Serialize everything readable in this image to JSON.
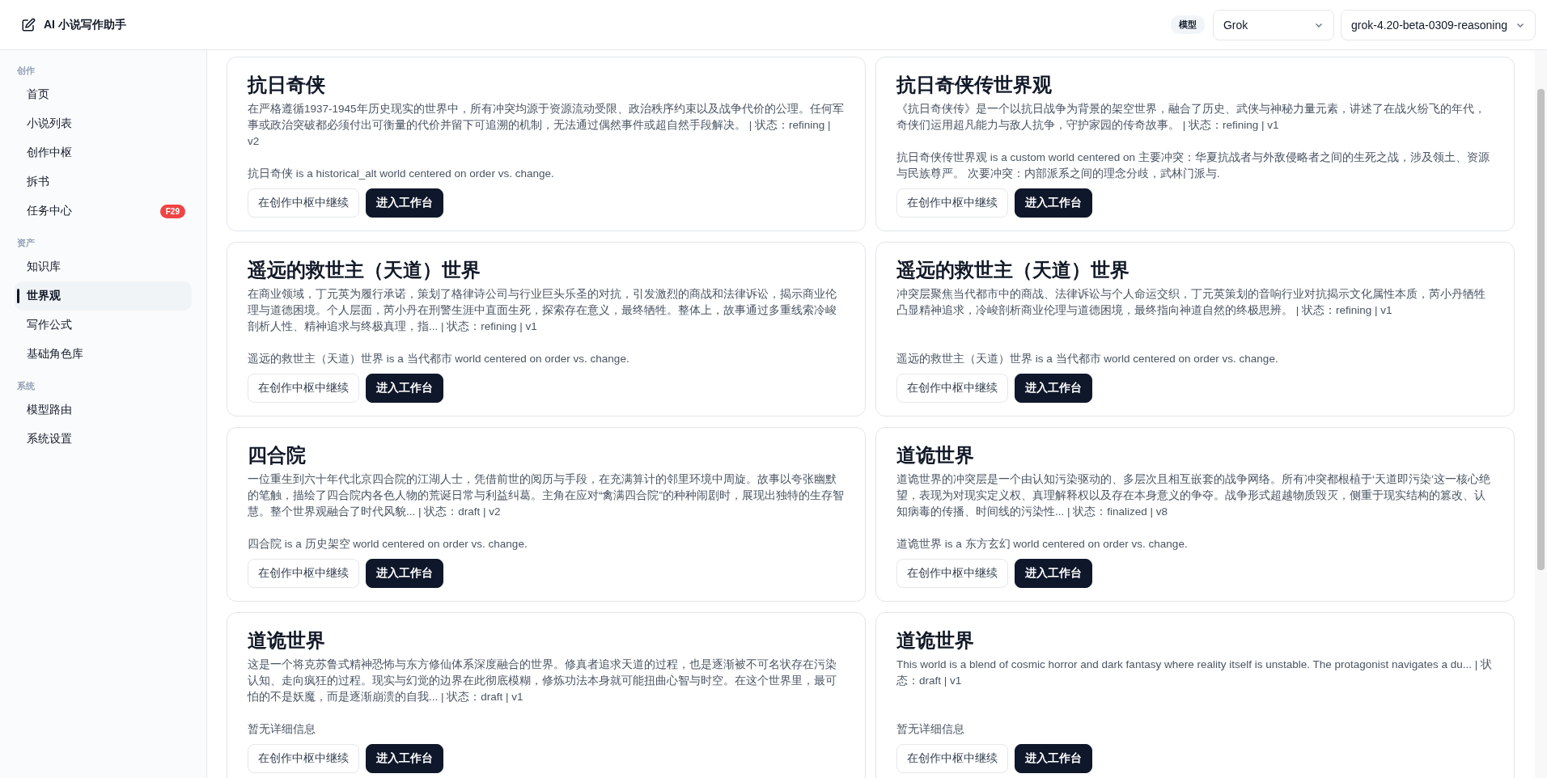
{
  "header": {
    "title": "AI 小说写作助手",
    "model_label": "模型",
    "provider_select": "Grok",
    "model_select": "grok-4.20-beta-0309-reasoning"
  },
  "sidebar": {
    "groups": [
      {
        "label": "创作",
        "items": [
          {
            "label": "首页",
            "selected": false
          },
          {
            "label": "小说列表",
            "selected": false
          },
          {
            "label": "创作中枢",
            "selected": false
          },
          {
            "label": "拆书",
            "selected": false
          },
          {
            "label": "任务中心",
            "selected": false,
            "badge": "F29"
          }
        ]
      },
      {
        "label": "资产",
        "items": [
          {
            "label": "知识库",
            "selected": false
          },
          {
            "label": "世界观",
            "selected": true
          },
          {
            "label": "写作公式",
            "selected": false
          },
          {
            "label": "基础角色库",
            "selected": false
          }
        ]
      },
      {
        "label": "系统",
        "items": [
          {
            "label": "模型路由",
            "selected": false
          },
          {
            "label": "系统设置",
            "selected": false
          }
        ]
      }
    ]
  },
  "cards": [
    {
      "title": "抗日奇侠",
      "description": "在严格遵循1937-1945年历史现实的世界中，所有冲突均源于资源流动受限、政治秩序约束以及战争代价的公理。任何军事或政治突破都必须付出可衡量的代价并留下可追溯的机制，无法通过偶然事件或超自然手段解决。 | 状态：refining | v2",
      "summary": "抗日奇侠 is a historical_alt world centered on order vs. change.",
      "continue_button": "在创作中枢中继续",
      "open_button": "进入工作台"
    },
    {
      "title": "抗日奇侠传世界观",
      "description": "《抗日奇侠传》是一个以抗日战争为背景的架空世界，融合了历史、武侠与神秘力量元素，讲述了在战火纷飞的年代，奇侠们运用超凡能力与敌人抗争，守护家园的传奇故事。 | 状态：refining | v1",
      "summary": "抗日奇侠传世界观 is a custom world centered on 主要冲突：华夏抗战者与外敌侵略者之间的生死之战，涉及领土、资源与民族尊严。 次要冲突：内部派系之间的理念分歧，武林门派与.",
      "continue_button": "在创作中枢中继续",
      "open_button": "进入工作台"
    },
    {
      "title": "遥远的救世主（天道）世界",
      "description": "在商业领域，丁元英为履行承诺，策划了格律诗公司与行业巨头乐圣的对抗，引发激烈的商战和法律诉讼，揭示商业伦理与道德困境。个人层面，芮小丹在刑警生涯中直面生死，探索存在意义，最终牺牲。整体上，故事通过多重线索冷峻剖析人性、精神追求与终极真理，指... | 状态：refining | v1",
      "summary": "遥远的救世主（天道）世界 is a 当代都市 world centered on order vs. change.",
      "continue_button": "在创作中枢中继续",
      "open_button": "进入工作台"
    },
    {
      "title": "遥远的救世主（天道）世界",
      "description": "冲突层聚焦当代都市中的商战、法律诉讼与个人命运交织，丁元英策划的音响行业对抗揭示文化属性本质，芮小丹牺牲凸显精神追求，冷峻剖析商业伦理与道德困境，最终指向神道自然的终极思辨。 | 状态：refining | v1",
      "summary": "遥远的救世主（天道）世界 is a 当代都市 world centered on order vs. change.",
      "continue_button": "在创作中枢中继续",
      "open_button": "进入工作台"
    },
    {
      "title": "四合院",
      "description": "一位重生到六十年代北京四合院的江湖人士，凭借前世的阅历与手段，在充满算计的邻里环境中周旋。故事以夸张幽默的笔触，描绘了四合院内各色人物的荒诞日常与利益纠葛。主角在应对“禽满四合院”的种种闹剧时，展现出独特的生存智慧。整个世界观融合了时代风貌... | 状态：draft | v2",
      "summary": "四合院 is a 历史架空 world centered on order vs. change.",
      "continue_button": "在创作中枢中继续",
      "open_button": "进入工作台"
    },
    {
      "title": "道诡世界",
      "description": "道诡世界的冲突层是一个由认知污染驱动的、多层次且相互嵌套的战争网络。所有冲突都根植于‘天道即污染’这一核心绝望，表现为对现实定义权、真理解释权以及存在本身意义的争夺。战争形式超越物质毁灭，侧重于现实结构的篡改、认知病毒的传播、时间线的污染性... | 状态：finalized | v8",
      "summary": "道诡世界 is a 东方玄幻 world centered on order vs. change.",
      "continue_button": "在创作中枢中继续",
      "open_button": "进入工作台"
    },
    {
      "title": "道诡世界",
      "description": "这是一个将克苏鲁式精神恐怖与东方修仙体系深度融合的世界。修真者追求天道的过程，也是逐渐被不可名状存在污染认知、走向疯狂的过程。现实与幻觉的边界在此彻底模糊，修炼功法本身就可能扭曲心智与时空。在这个世界里，最可怕的不是妖魔，而是逐渐崩溃的自我... | 状态：draft | v1",
      "summary": "暂无详细信息",
      "continue_button": "在创作中枢中继续",
      "open_button": "进入工作台"
    },
    {
      "title": "道诡世界",
      "description": "This world is a blend of cosmic horror and dark fantasy where reality itself is unstable. The protagonist navigates a du... | 状态：draft | v1",
      "summary": "暂无详细信息",
      "continue_button": "在创作中枢中继续",
      "open_button": "进入工作台"
    }
  ]
}
